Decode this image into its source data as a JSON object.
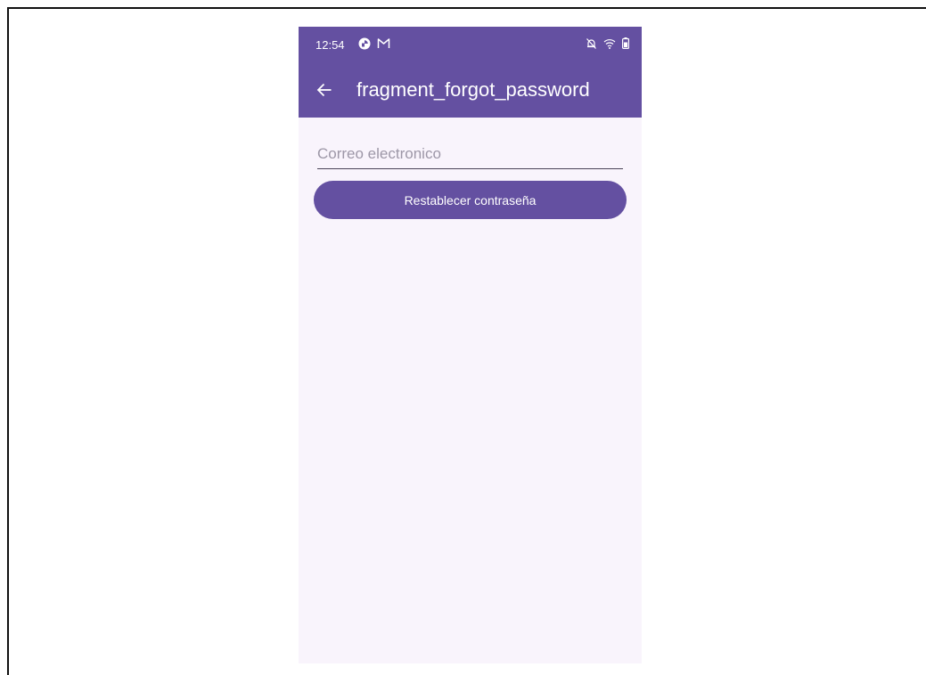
{
  "status_bar": {
    "time": "12:54",
    "left_icons": [
      "app-notification-icon",
      "gmail-icon"
    ],
    "right_icons": [
      "notifications-off-icon",
      "wifi-icon",
      "battery-icon"
    ]
  },
  "app_bar": {
    "title": "fragment_forgot_password",
    "back_icon": "arrow-back-icon"
  },
  "form": {
    "email_placeholder": "Correo electronico",
    "email_value": "",
    "reset_button_label": "Restablecer contraseña"
  },
  "colors": {
    "primary": "#6450a1",
    "background": "#f9f4fc",
    "on_primary": "#ffffff",
    "hint": "#9d97a7"
  }
}
